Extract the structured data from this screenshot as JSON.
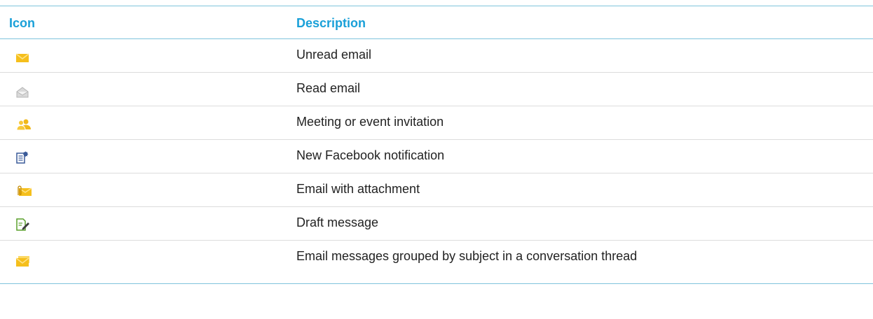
{
  "header": {
    "icon_label": "Icon",
    "description_label": "Description"
  },
  "colors": {
    "header_text": "#1aa0d8",
    "rule": "#7fc4dc",
    "row_divider": "#dcdcdc",
    "body_text": "#222222"
  },
  "rows": [
    {
      "icon": "unread-email-icon",
      "description": "Unread email"
    },
    {
      "icon": "read-email-icon",
      "description": "Read email"
    },
    {
      "icon": "meeting-invitation-icon",
      "description": "Meeting or event invitation"
    },
    {
      "icon": "facebook-notification-icon",
      "description": "New Facebook notification"
    },
    {
      "icon": "email-attachment-icon",
      "description": "Email with attachment"
    },
    {
      "icon": "draft-message-icon",
      "description": "Draft message"
    },
    {
      "icon": "conversation-thread-icon",
      "description": "Email messages grouped by subject in a conversation thread"
    }
  ]
}
